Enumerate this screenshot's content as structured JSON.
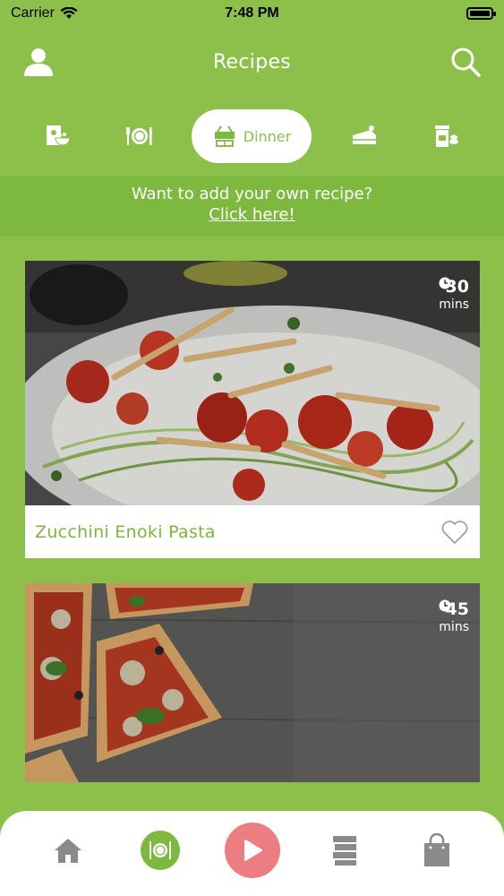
{
  "status_bar": {
    "carrier": "Carrier",
    "time": "7:48 PM"
  },
  "header": {
    "title": "Recipes",
    "left_icon": "user-icon",
    "right_icon": "search-icon"
  },
  "categories": [
    {
      "icon": "salad-book-icon",
      "label": ""
    },
    {
      "icon": "plate-cutlery-icon",
      "label": ""
    },
    {
      "icon": "dinner-basket-icon",
      "label": "Dinner",
      "active": true
    },
    {
      "icon": "cake-icon",
      "label": ""
    },
    {
      "icon": "jar-icon",
      "label": ""
    }
  ],
  "banner": {
    "text": "Want to add your own recipe?",
    "link": "Click here!"
  },
  "recipes": [
    {
      "title": "Zucchini Enoki Pasta",
      "time": "30",
      "unit": "mins",
      "favorite": false
    },
    {
      "title": "",
      "time": "45",
      "unit": "mins",
      "favorite": false
    }
  ],
  "bottom_nav": [
    {
      "icon": "home-icon"
    },
    {
      "icon": "recipes-icon",
      "active": true
    },
    {
      "icon": "play-icon"
    },
    {
      "icon": "notes-icon"
    },
    {
      "icon": "shopping-bag-icon"
    }
  ],
  "colors": {
    "primary": "#8cc04b",
    "banner": "#7db93f",
    "title": "#7fb43f",
    "play": "#ec7d80"
  }
}
